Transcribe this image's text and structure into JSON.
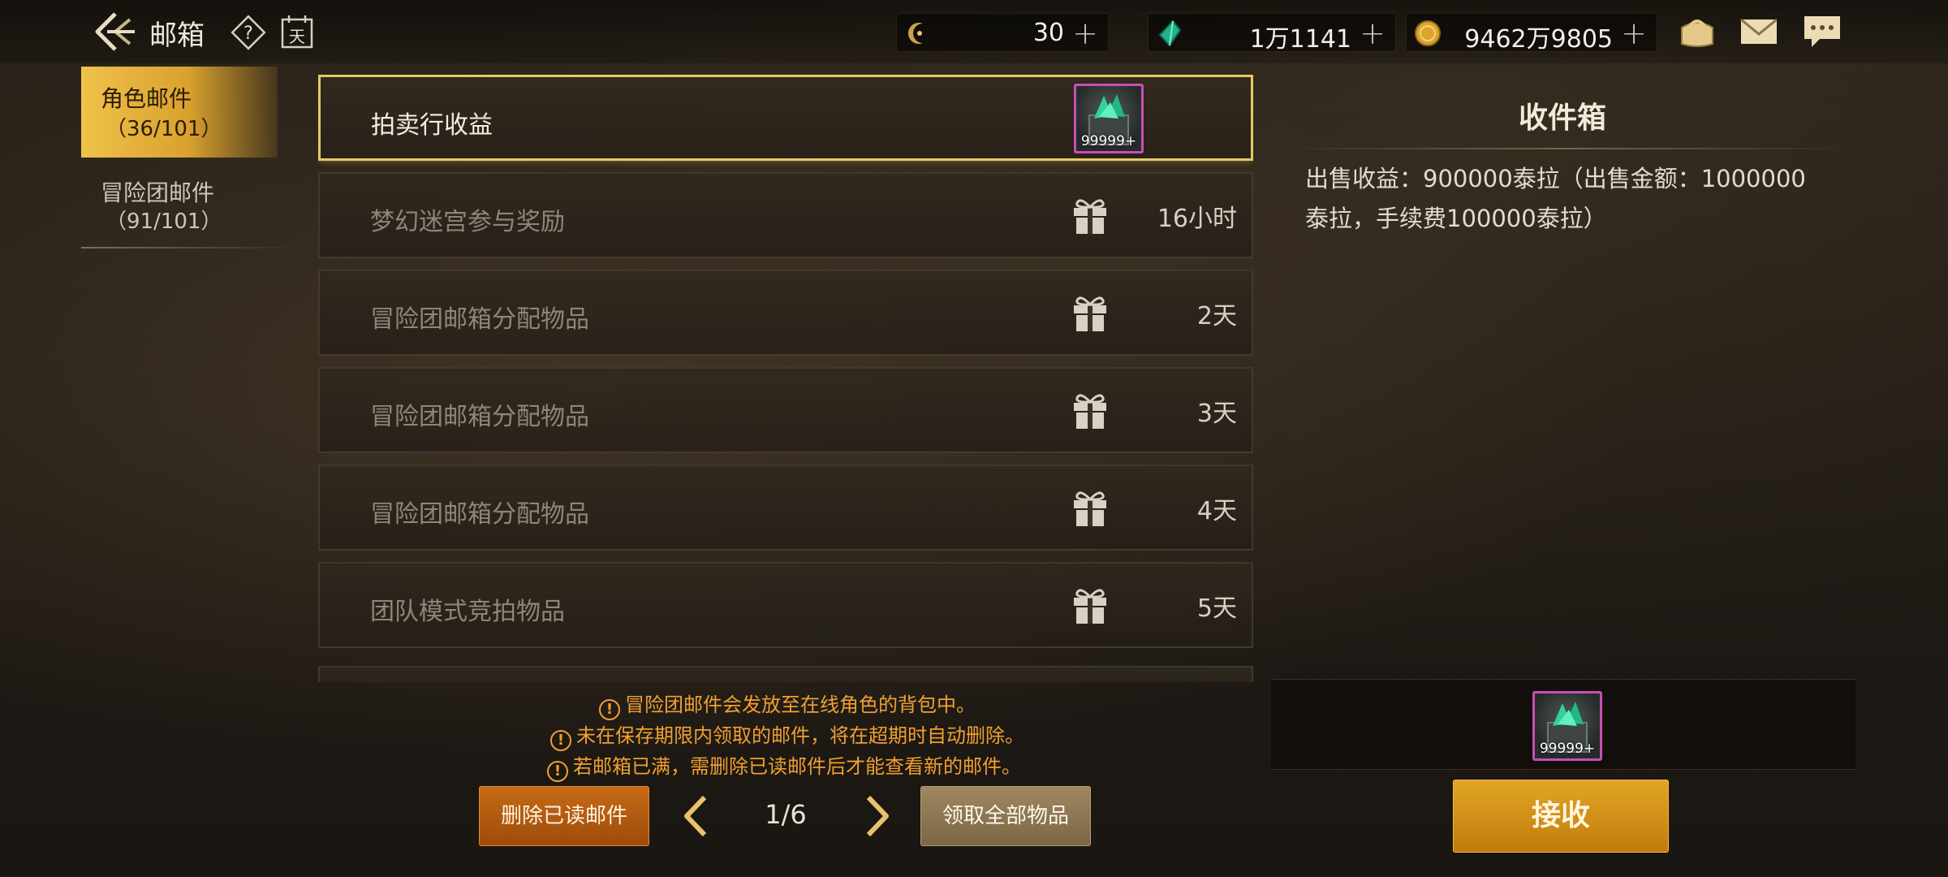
{
  "header": {
    "title": "邮箱",
    "calendar_label": "天",
    "help_label": "?"
  },
  "currencies": [
    {
      "icon": "crescent-coin-icon",
      "value": "30",
      "plus": "+"
    },
    {
      "icon": "green-crystal-icon",
      "value": "1万1141",
      "plus": "+"
    },
    {
      "icon": "gold-coin-icon",
      "value": "9462万9805",
      "plus": "+"
    }
  ],
  "top_icons": [
    "wallet-icon",
    "mail-icon",
    "chat-icon"
  ],
  "tabs": [
    {
      "label": "角色邮件",
      "count": "（36/101）",
      "active": true
    },
    {
      "label": "冒险团邮件",
      "count": "（91/101）",
      "active": false
    }
  ],
  "mails": [
    {
      "title": "拍卖行收益",
      "time": "",
      "attachment_count": "99999+",
      "selected": true
    },
    {
      "title": "梦幻迷宫参与奖励",
      "time": "16小时",
      "selected": false
    },
    {
      "title": "冒险团邮箱分配物品",
      "time": "2天",
      "selected": false
    },
    {
      "title": "冒险团邮箱分配物品",
      "time": "3天",
      "selected": false
    },
    {
      "title": "冒险团邮箱分配物品",
      "time": "4天",
      "selected": false
    },
    {
      "title": "团队模式竞拍物品",
      "time": "5天",
      "selected": false
    }
  ],
  "notices": [
    "冒险团邮件会发放至在线角色的背包中。",
    "未在保存期限内领取的邮件，将在超期时自动删除。",
    "若邮箱已满，需删除已读邮件后才能查看新的邮件。"
  ],
  "controls": {
    "delete_read": "删除已读邮件",
    "page": "1/6",
    "claim_all": "领取全部物品"
  },
  "detail": {
    "title": "收件箱",
    "body": "出售收益：900000泰拉（出售金额：1000000泰拉，手续费100000泰拉）",
    "attachment_count": "99999+",
    "receive": "接收"
  },
  "colors": {
    "accent_gold": "#e8c866",
    "notice_orange": "#f0a030",
    "delete_button": "#c76a16",
    "receive_button": "#e2a526",
    "item_border": "#c84fb4"
  }
}
